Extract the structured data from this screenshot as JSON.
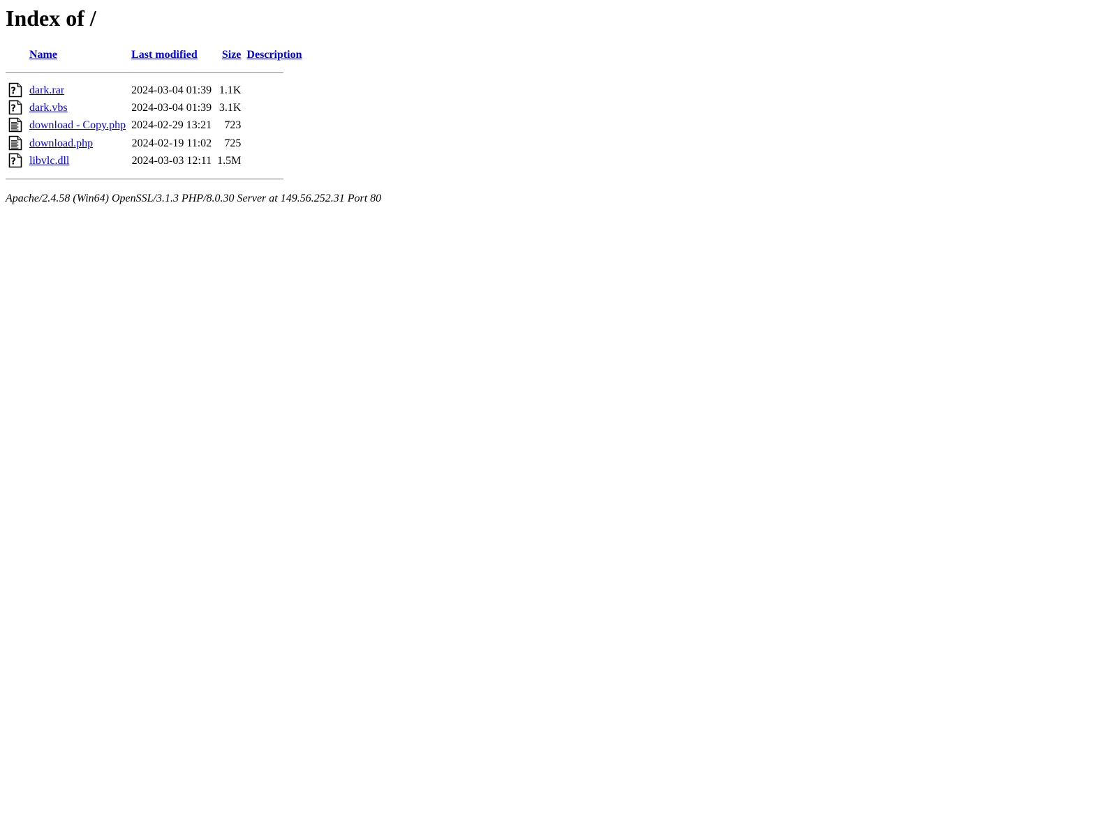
{
  "page": {
    "title": "Index of /"
  },
  "table": {
    "headers": [
      {
        "key": "icon",
        "label": ""
      },
      {
        "key": "name",
        "label": "Name"
      },
      {
        "key": "date",
        "label": "Last modified"
      },
      {
        "key": "size",
        "label": "Size"
      },
      {
        "key": "desc",
        "label": "Description"
      }
    ],
    "rows": [
      {
        "icon": "unknown-file-icon",
        "icon_alt": "[   ]",
        "name": "dark.rar",
        "date": "2024-03-04 01:39",
        "size": "1.1K",
        "description": ""
      },
      {
        "icon": "unknown-file-icon",
        "icon_alt": "[   ]",
        "name": "dark.vbs",
        "date": "2024-03-04 01:39",
        "size": "3.1K",
        "description": ""
      },
      {
        "icon": "text-file-icon",
        "icon_alt": "[TXT]",
        "name": "download - Copy.php",
        "date": "2024-02-29 13:21",
        "size": "723",
        "description": ""
      },
      {
        "icon": "text-file-icon",
        "icon_alt": "[TXT]",
        "name": "download.php",
        "date": "2024-02-19 11:02",
        "size": "725",
        "description": ""
      },
      {
        "icon": "unknown-file-icon",
        "icon_alt": "[   ]",
        "name": "libvlc.dll",
        "date": "2024-03-03 12:11",
        "size": "1.5M",
        "description": ""
      }
    ]
  },
  "footer": {
    "server_signature": "Apache/2.4.58 (Win64) OpenSSL/3.1.3 PHP/8.0.30 Server at 149.56.252.31 Port 80"
  },
  "colors": {
    "link": "#0000EE",
    "text": "#000000",
    "background": "#FFFFFF",
    "rule": "#9C9C9C"
  }
}
